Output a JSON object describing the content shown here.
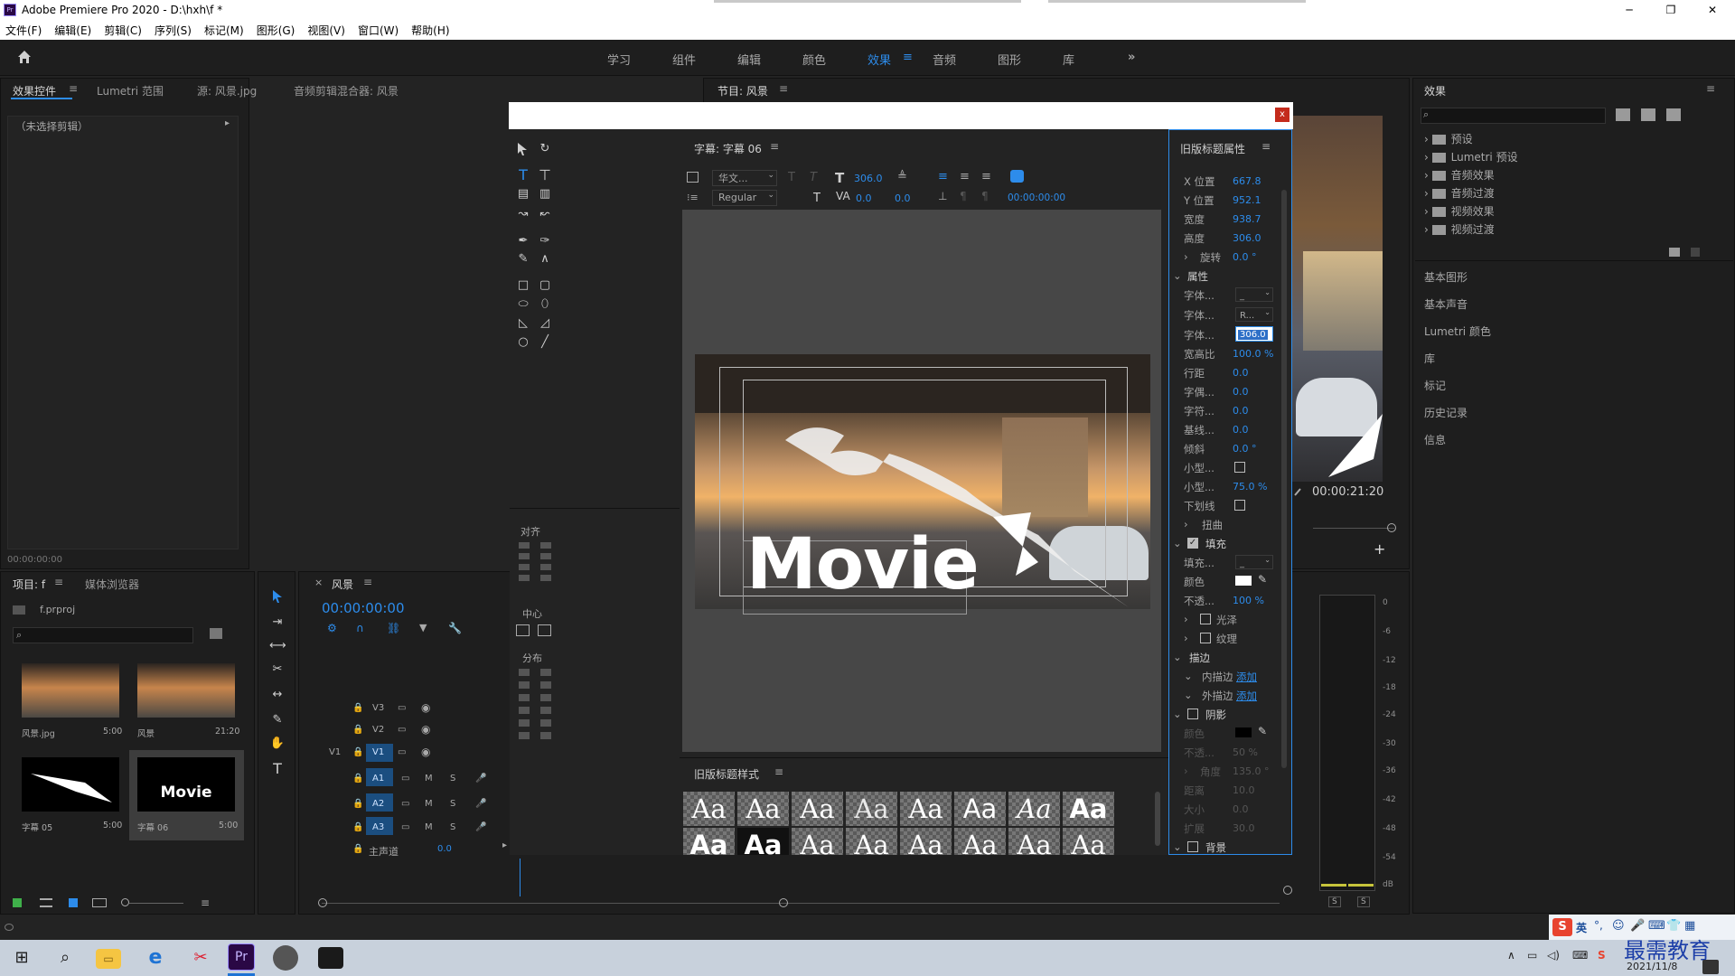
{
  "app": {
    "title": "Adobe Premiere Pro 2020 - D:\\hxh\\f *",
    "logo": "Pr"
  },
  "window_controls": {
    "minimize": "─",
    "maximize": "❐",
    "close": "✕"
  },
  "menu": [
    "文件(F)",
    "编辑(E)",
    "剪辑(C)",
    "序列(S)",
    "标记(M)",
    "图形(G)",
    "视图(V)",
    "窗口(W)",
    "帮助(H)"
  ],
  "workspaces": [
    "学习",
    "组件",
    "编辑",
    "颜色",
    "效果",
    "音频",
    "图形",
    "库"
  ],
  "workspace_active": "效果",
  "left_tabs": {
    "effect_controls": "效果控件",
    "lumetri_scope": "Lumetri 范围",
    "source": "源: 风景.jpg",
    "audio_mixer": "音频剪辑混合器: 风景"
  },
  "no_clip": "（未选择剪辑）",
  "ec_time": "00:00:00:00",
  "program": {
    "title": "节目: 风景",
    "timecode": "00:00:21:20"
  },
  "project": {
    "title": "项目: f",
    "media_browser": "媒体浏览器",
    "file": "f.prproj",
    "items": [
      {
        "name": "风景.jpg",
        "dur": "5:00"
      },
      {
        "name": "风景",
        "dur": "21:20"
      },
      {
        "name": "字幕 05",
        "dur": "5:00"
      },
      {
        "name": "字幕 06",
        "dur": "5:00"
      }
    ]
  },
  "timeline": {
    "title": "风景",
    "timecode": "00:00:00:00",
    "tracks": [
      "V3",
      "V2",
      "V1",
      "A1",
      "A2",
      "A3"
    ],
    "v1_src": "V1",
    "master": "主声道",
    "master_val": "0.0",
    "m": "M",
    "s": "S"
  },
  "titler": {
    "subtitle_label": "字幕: 字幕 06",
    "font_family": "华文...",
    "font_style": "Regular",
    "font_size": "306.0",
    "kerning": "0.0",
    "leading": "0.0",
    "tab_time": "00:00:00:00",
    "align_label": "对齐",
    "center_label": "中心",
    "distribute_label": "分布",
    "canvas_text": "Movie",
    "styles_label": "旧版标题样式",
    "style_sample": "Aa",
    "close": "x"
  },
  "props": {
    "header": "旧版标题属性",
    "rows": [
      {
        "k": "X 位置",
        "v": "667.8"
      },
      {
        "k": "Y 位置",
        "v": "952.1"
      },
      {
        "k": "宽度",
        "v": "938.7"
      },
      {
        "k": "高度",
        "v": "306.0"
      },
      {
        "k": "旋转",
        "v": "0.0 °"
      }
    ],
    "section_props": "属性",
    "rows2": [
      {
        "k": "字体...",
        "v": "_"
      },
      {
        "k": "字体...",
        "v": "R..."
      },
      {
        "k": "字体...",
        "v": "306.0"
      },
      {
        "k": "宽高比",
        "v": "100.0 %"
      },
      {
        "k": "行距",
        "v": "0.0"
      },
      {
        "k": "字偶...",
        "v": "0.0"
      },
      {
        "k": "字符...",
        "v": "0.0"
      },
      {
        "k": "基线...",
        "v": "0.0"
      },
      {
        "k": "倾斜",
        "v": "0.0 °"
      },
      {
        "k": "小型...",
        "v": ""
      },
      {
        "k": "小型...",
        "v": "75.0 %"
      },
      {
        "k": "下划线",
        "v": ""
      }
    ],
    "distort": "扭曲",
    "fill": "填充",
    "fill_type": "填充...",
    "fill_type_val": "_",
    "color": "颜色",
    "opacity": "不透...",
    "opacity_val": "100 %",
    "sheen": "光泽",
    "texture": "纹理",
    "stroke": "描边",
    "inner": "内描边",
    "outer": "外描边",
    "add": "添加",
    "shadow": "阴影",
    "sh_color": "颜色",
    "sh_op": "不透...",
    "sh_op_val": "50 %",
    "sh_angle": "角度",
    "sh_angle_val": "135.0 °",
    "sh_dist": "距离",
    "sh_dist_val": "10.0",
    "sh_size": "大小",
    "sh_size_val": "0.0",
    "sh_spread": "扩展",
    "sh_spread_val": "30.0",
    "background": "背景"
  },
  "effects": {
    "title": "效果",
    "items": [
      "预设",
      "Lumetri 预设",
      "音频效果",
      "音频过渡",
      "视频效果",
      "视频过渡"
    ],
    "panels": [
      "基本图形",
      "基本声音",
      "Lumetri 颜色",
      "库",
      "标记",
      "历史记录",
      "信息"
    ]
  },
  "meter": {
    "scale": [
      "0",
      "-6",
      "-12",
      "-18",
      "-24",
      "-30",
      "-36",
      "-42",
      "-48",
      "-54",
      "dB"
    ],
    "s": "S"
  },
  "taskbar": {
    "time": "",
    "date": "2021/11/8",
    "watermark": "最需教育",
    "ime": "英"
  }
}
